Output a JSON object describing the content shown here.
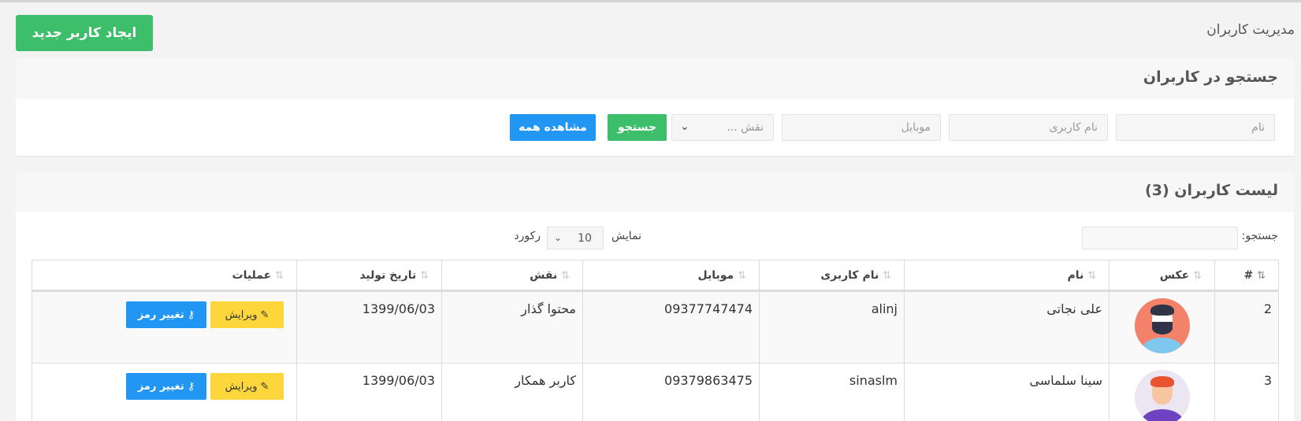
{
  "header": {
    "page_title": "مدیریت کاربران",
    "new_user_button": "ایجاد کاربر جدید"
  },
  "search_panel": {
    "title": "جستجو در کاربران",
    "name_placeholder": "نام",
    "username_placeholder": "نام کاربری",
    "mobile_placeholder": "موبایل",
    "role_select": "نقش ...",
    "search_button": "جستجو",
    "show_all_button": "مشاهده همه"
  },
  "list_panel": {
    "title": "لیست کاربران (3)",
    "search_label": "جستجو:",
    "length_show": "نمایش",
    "length_value": "10",
    "length_records": "رکورد"
  },
  "table": {
    "columns": [
      "#",
      "عکس",
      "نام",
      "نام کاربری",
      "موبایل",
      "نقش",
      "تاریخ تولید",
      "عملیات"
    ],
    "rows": [
      {
        "id": "2",
        "name": "علی نجاتی",
        "username": "alinj",
        "mobile": "09377747474",
        "role": "محتوا گذار",
        "created": "1399/06/03",
        "avatar": "man-beard-avatar"
      },
      {
        "id": "3",
        "name": "سینا سلماسی",
        "username": "sinaslm",
        "mobile": "09379863475",
        "role": "کاربر همکار",
        "created": "1399/06/03",
        "avatar": "boy-redhair-avatar"
      }
    ],
    "edit_label": "ویرایش",
    "change_password_label": "تغییر رمز"
  },
  "colors": {
    "green": "#3dbe6a",
    "blue": "#2196f3",
    "yellow": "#fcd63a"
  }
}
